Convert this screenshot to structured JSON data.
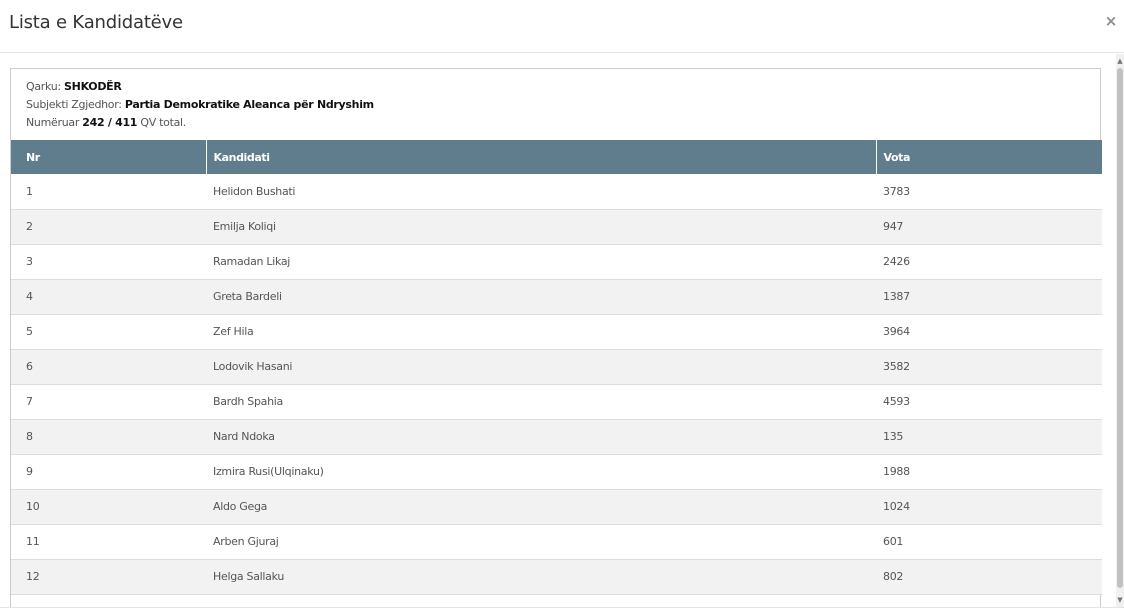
{
  "modal": {
    "title": "Lista e Kandidatëve",
    "close_label": "×"
  },
  "info": {
    "qarku_label": "Qarku:",
    "qarku_value": "SHKODËR",
    "subjekti_label": "Subjekti Zgjedhor:",
    "subjekti_value": "Partia Demokratike Aleanca për Ndryshim",
    "numeruar_label": "Numëruar",
    "numeruar_value": "242 / 411",
    "numeruar_suffix": "QV total."
  },
  "table": {
    "headers": {
      "nr": "Nr",
      "name": "Kandidati",
      "votes": "Vota"
    },
    "rows": [
      {
        "nr": "1",
        "name": "Helidon Bushati",
        "votes": "3783"
      },
      {
        "nr": "2",
        "name": "Emilja Koliqi",
        "votes": "947"
      },
      {
        "nr": "3",
        "name": "Ramadan Likaj",
        "votes": "2426"
      },
      {
        "nr": "4",
        "name": "Greta Bardeli",
        "votes": "1387"
      },
      {
        "nr": "5",
        "name": "Zef Hila",
        "votes": "3964"
      },
      {
        "nr": "6",
        "name": "Lodovik Hasani",
        "votes": "3582"
      },
      {
        "nr": "7",
        "name": "Bardh Spahia",
        "votes": "4593"
      },
      {
        "nr": "8",
        "name": "Nard Ndoka",
        "votes": "135"
      },
      {
        "nr": "9",
        "name": "Izmira Rusi(Ulqinaku)",
        "votes": "1988"
      },
      {
        "nr": "10",
        "name": "Aldo Gega",
        "votes": "1024"
      },
      {
        "nr": "11",
        "name": "Arben Gjuraj",
        "votes": "601"
      },
      {
        "nr": "12",
        "name": "Helga Sallaku",
        "votes": "802"
      }
    ]
  },
  "scrollbar": {
    "up_icon": "▲",
    "down_icon": "▼"
  }
}
